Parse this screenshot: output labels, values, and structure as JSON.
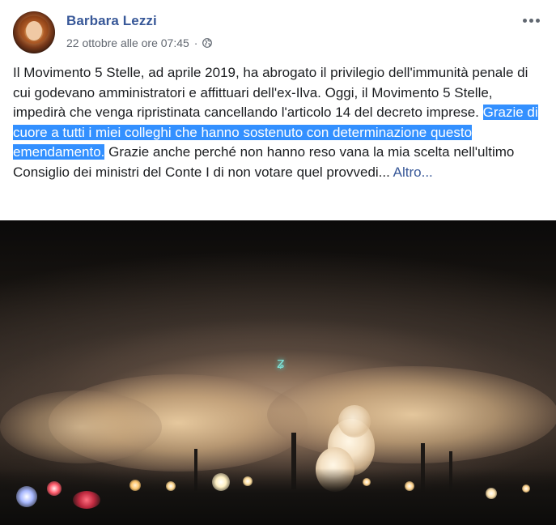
{
  "post": {
    "author": "Barbara Lezzi",
    "timestamp": "22 ottobre alle ore 07:45",
    "separator": "·",
    "privacy_icon": "globe-icon",
    "more_icon": "more-options-icon",
    "text_before": "Il Movimento 5 Stelle, ad aprile 2019, ha abrogato il privilegio dell'immunità penale di cui godevano amministratori e affittuari dell'ex-Ilva. Oggi, il Movimento 5 Stelle, impedirà che venga ripristinata cancellando l'articolo 14 del decreto imprese. ",
    "text_highlighted": "Grazie di cuore a tutti i miei colleghi che hanno sostenuto con determinazione questo emendamento.",
    "text_after": " Grazie anche perché non hanno reso vana la mia scelta nell'ultimo Consiglio dei ministri del Conte I di non votare quel provvedi... ",
    "see_more": "Altro...",
    "photo_icon": "night-industrial-photo",
    "colors": {
      "author": "#385898",
      "meta": "#616770",
      "highlight": "#3390ff",
      "link": "#385898"
    }
  }
}
